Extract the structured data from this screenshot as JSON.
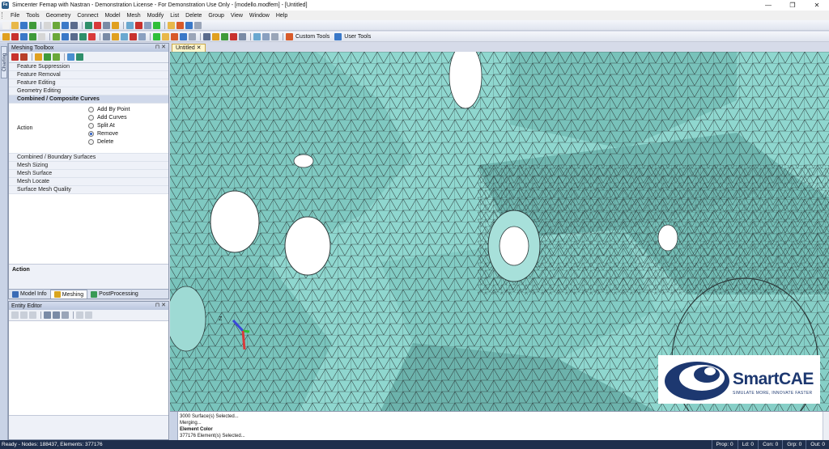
{
  "window": {
    "title": "Simcenter Femap with Nastran - Demonstration License - For Demonstration Use Only - [modello.modfem] - [Untitled]",
    "minimize": "—",
    "restore": "❐",
    "close": "✕"
  },
  "menu": [
    "File",
    "Tools",
    "Geometry",
    "Connect",
    "Model",
    "Mesh",
    "Modify",
    "List",
    "Delete",
    "Group",
    "View",
    "Window",
    "Help"
  ],
  "toolbars": {
    "custom_tools": "Custom Tools",
    "user_tools": "User Tools"
  },
  "left_strip": {
    "tab_label": "Charting"
  },
  "meshing_toolbox": {
    "title": "Meshing Toolbox",
    "header_buttons": "⊓ ✕",
    "items_top": [
      "Feature Suppression",
      "Feature Removal",
      "Feature Editing",
      "Geometry Editing"
    ],
    "selected_tool": "Combined / Composite Curves",
    "action_label": "Action",
    "action_options": [
      {
        "label": "Add By Point",
        "checked": false
      },
      {
        "label": "Add Curves",
        "checked": false
      },
      {
        "label": "Split At",
        "checked": false
      },
      {
        "label": "Remove",
        "checked": true
      },
      {
        "label": "Delete",
        "checked": false
      }
    ],
    "items_bottom": [
      "Combined / Boundary Surfaces",
      "Mesh Sizing",
      "Mesh Surface",
      "Mesh Locate",
      "Surface Mesh Quality"
    ],
    "help_title": "Action",
    "tabs": [
      "Model Info",
      "Meshing",
      "PostProcessing"
    ]
  },
  "entity_editor": {
    "title": "Entity Editor",
    "header_buttons": "⊓ ✕"
  },
  "view": {
    "tab_label": "Untitled",
    "triad_label": "Z",
    "mesh_color": "#8fd7cf"
  },
  "logo": {
    "brand": "SmartCAE",
    "tagline": "SIMULATE MORE, INNOVATE FASTER"
  },
  "messages": [
    "3000 Surface(s) Selected...",
    "Merging...",
    "Element Color",
    "377176 Element(s) Selected..."
  ],
  "status": {
    "left": "Ready - Nodes: 188437,  Elements: 377176",
    "cells": [
      "Prop: 0",
      "Ld: 0",
      "Con: 0",
      "Grp: 0",
      "Out: 0"
    ]
  }
}
